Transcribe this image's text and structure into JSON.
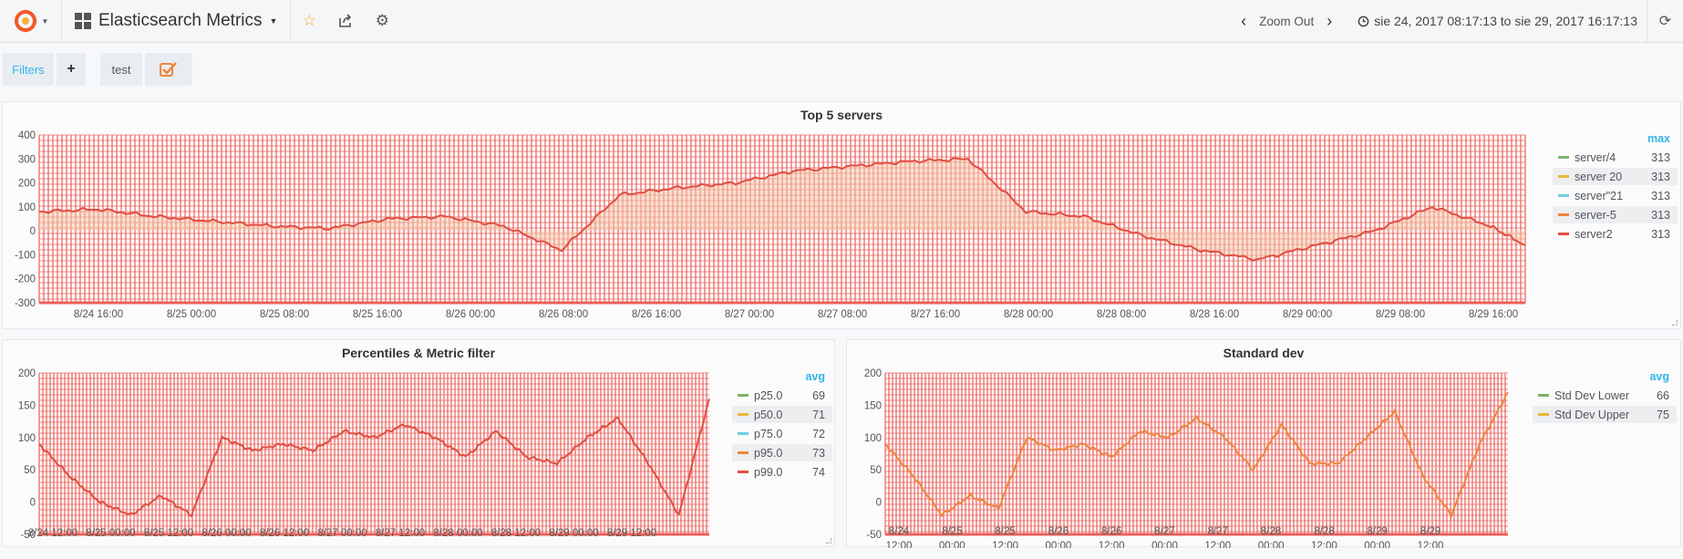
{
  "navbar": {
    "title": "Elasticsearch Metrics",
    "zoom_label": "Zoom Out",
    "time_range": "sie 24, 2017 08:17:13 to sie 29, 2017 16:17:13"
  },
  "filters": {
    "filters_label": "Filters",
    "add_label": "+",
    "test_label": "test"
  },
  "colors": {
    "accent": "#33b5e5",
    "series_red": "#e24d42",
    "grid_red": "#ec5f59",
    "green": "#7eb26d",
    "yellow": "#eab839",
    "cyan": "#6ed0e0",
    "orange": "#ef843c"
  },
  "panels": [
    {
      "title": "Top 5 servers",
      "legend_header": "max",
      "legend": [
        {
          "name": "server/4",
          "value": "313",
          "color": "#7eb26d"
        },
        {
          "name": "server 20",
          "value": "313",
          "color": "#eab839"
        },
        {
          "name": "server\"21",
          "value": "313",
          "color": "#6ed0e0"
        },
        {
          "name": "server-5",
          "value": "313",
          "color": "#ef843c"
        },
        {
          "name": "server2",
          "value": "313",
          "color": "#e24d42"
        }
      ]
    },
    {
      "title": "Percentiles & Metric filter",
      "legend_header": "avg",
      "legend": [
        {
          "name": "p25.0",
          "value": "69",
          "color": "#7eb26d"
        },
        {
          "name": "p50.0",
          "value": "71",
          "color": "#eab839"
        },
        {
          "name": "p75.0",
          "value": "72",
          "color": "#6ed0e0"
        },
        {
          "name": "p95.0",
          "value": "73",
          "color": "#ef843c"
        },
        {
          "name": "p99.0",
          "value": "74",
          "color": "#e24d42"
        }
      ]
    },
    {
      "title": "Standard dev",
      "legend_header": "avg",
      "legend": [
        {
          "name": "Std Dev Lower",
          "value": "66",
          "color": "#7eb26d"
        },
        {
          "name": "Std Dev Upper",
          "value": "75",
          "color": "#eab839"
        }
      ]
    }
  ],
  "chart_data": [
    {
      "type": "line",
      "title": "Top 5 servers",
      "ylim": [
        -300,
        400
      ],
      "y_ticks": [
        "400",
        "300",
        "200",
        "100",
        "0",
        "-100",
        "-200",
        "-300"
      ],
      "x_ticks": [
        "8/24 16:00",
        "8/25 00:00",
        "8/25 08:00",
        "8/25 16:00",
        "8/26 00:00",
        "8/26 08:00",
        "8/26 16:00",
        "8/27 00:00",
        "8/27 08:00",
        "8/27 16:00",
        "8/28 00:00",
        "8/28 08:00",
        "8/28 16:00",
        "8/29 00:00",
        "8/29 08:00",
        "8/29 16:00"
      ],
      "x_hours": [
        0,
        5,
        10,
        15,
        20,
        25,
        30,
        35,
        40,
        45,
        50,
        55,
        60,
        65,
        70,
        75,
        80,
        85,
        90,
        95,
        100,
        105,
        110,
        115,
        120,
        125,
        128
      ],
      "series": [
        {
          "name": "server2",
          "values": [
            80,
            90,
            60,
            40,
            20,
            10,
            50,
            60,
            20,
            -80,
            150,
            180,
            200,
            250,
            270,
            290,
            300,
            80,
            60,
            -20,
            -80,
            -120,
            -60,
            0,
            100,
            20,
            -60
          ]
        }
      ]
    },
    {
      "type": "line",
      "title": "Percentiles & Metric filter",
      "ylim": [
        -50,
        200
      ],
      "y_ticks": [
        "200",
        "150",
        "100",
        "50",
        "0",
        "-50"
      ],
      "x_ticks": [
        "8/24 12:00",
        "8/25 00:00",
        "8/25 12:00",
        "8/26 00:00",
        "8/26 12:00",
        "8/27 00:00",
        "8/27 12:00",
        "8/28 00:00",
        "8/28 12:00",
        "8/29 00:00",
        "8/29 12:00"
      ],
      "x_hours": [
        0,
        6,
        12,
        18,
        24,
        30,
        36,
        42,
        48,
        54,
        60,
        66,
        72,
        78,
        84,
        90,
        96,
        102,
        108,
        114,
        120,
        126,
        132
      ],
      "series": [
        {
          "name": "p99.0",
          "values": [
            90,
            40,
            0,
            -20,
            10,
            -20,
            100,
            80,
            90,
            80,
            110,
            100,
            120,
            100,
            70,
            110,
            70,
            60,
            100,
            130,
            60,
            -20,
            160
          ]
        }
      ]
    },
    {
      "type": "line",
      "title": "Standard dev",
      "ylim": [
        -50,
        200
      ],
      "y_ticks": [
        "200",
        "150",
        "100",
        "50",
        "0",
        "-50"
      ],
      "x_ticks": [
        "8/24\n12:00",
        "8/25\n00:00",
        "8/25\n12:00",
        "8/26\n00:00",
        "8/26\n12:00",
        "8/27\n00:00",
        "8/27\n12:00",
        "8/28\n00:00",
        "8/28\n12:00",
        "8/29\n00:00",
        "8/29\n12:00"
      ],
      "x_hours": [
        0,
        6,
        12,
        18,
        24,
        30,
        36,
        42,
        48,
        54,
        60,
        66,
        72,
        78,
        84,
        90,
        96,
        102,
        108,
        114,
        120,
        126,
        132
      ],
      "series": [
        {
          "name": "Std Dev Upper",
          "values": [
            90,
            40,
            -20,
            10,
            -10,
            100,
            80,
            90,
            70,
            110,
            100,
            130,
            100,
            50,
            120,
            60,
            60,
            100,
            140,
            40,
            -20,
            90,
            170
          ]
        }
      ]
    }
  ]
}
